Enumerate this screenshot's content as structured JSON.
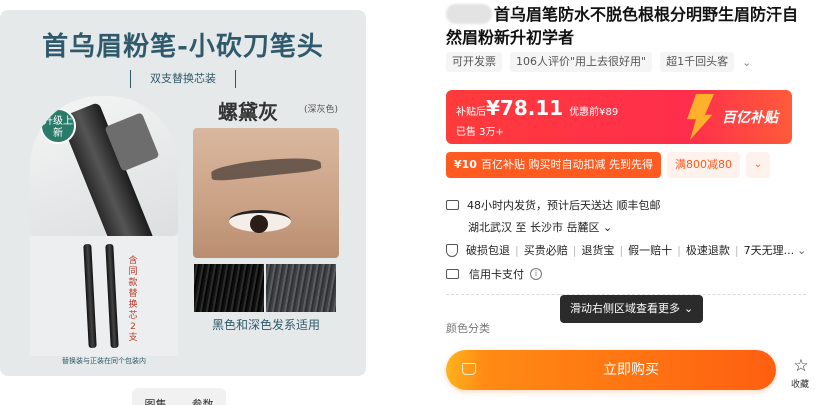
{
  "gallery": {
    "banner_title": "首乌眉粉笔-小砍刀笔头",
    "banner_subtitle": "双支替换芯装",
    "upgrade_badge": "升级上新",
    "color_name": "螺黛灰",
    "color_note": "(深灰色)",
    "refill_label": "含同款替换芯2支",
    "refill_caption": "替换装与正装在同个包装内",
    "hair_caption": "黑色和深色发系适用",
    "tabs": [
      "图集",
      "参数"
    ]
  },
  "product": {
    "title": "首乌眉笔防水不脱色根根分明野生眉防汗自然眉粉新升初学者",
    "tags": [
      "可开发票",
      "106人评价\"用上去很好用\"",
      "超1千回头客"
    ]
  },
  "price": {
    "prefix": "补贴后",
    "value": "¥78.11",
    "original": "优惠前¥89",
    "sold": "已售 3万+",
    "subsidy_logo": "百亿补贴"
  },
  "coupon": {
    "amount": "¥10",
    "text": "百亿补贴 购买时自动扣减 先到先得",
    "alt": "满800减80"
  },
  "shipping": {
    "line1": "48小时内发货，预计后天送达  顺丰包邮",
    "line2": "湖北武汉 至 长沙市 岳麓区"
  },
  "guarantees": [
    "破损包退",
    "买贵必赔",
    "退货宝",
    "假一赔十",
    "极速退款",
    "7天无理..."
  ],
  "payment": {
    "label": "信用卡支付"
  },
  "tooltip": "滑动右侧区域查看更多",
  "color_section": "颜色分类",
  "buy_button": "立即购买",
  "favorite_label": "收藏",
  "colors": {
    "accent": "#ff5a1f",
    "price_panel": "#ff3b3b",
    "subsidy_bolt": "#ffb12b"
  },
  "icons": [
    "truck-icon",
    "location-icon",
    "shield-icon",
    "card-icon",
    "info-icon",
    "cart-icon",
    "star-icon",
    "chevron-down-icon"
  ]
}
